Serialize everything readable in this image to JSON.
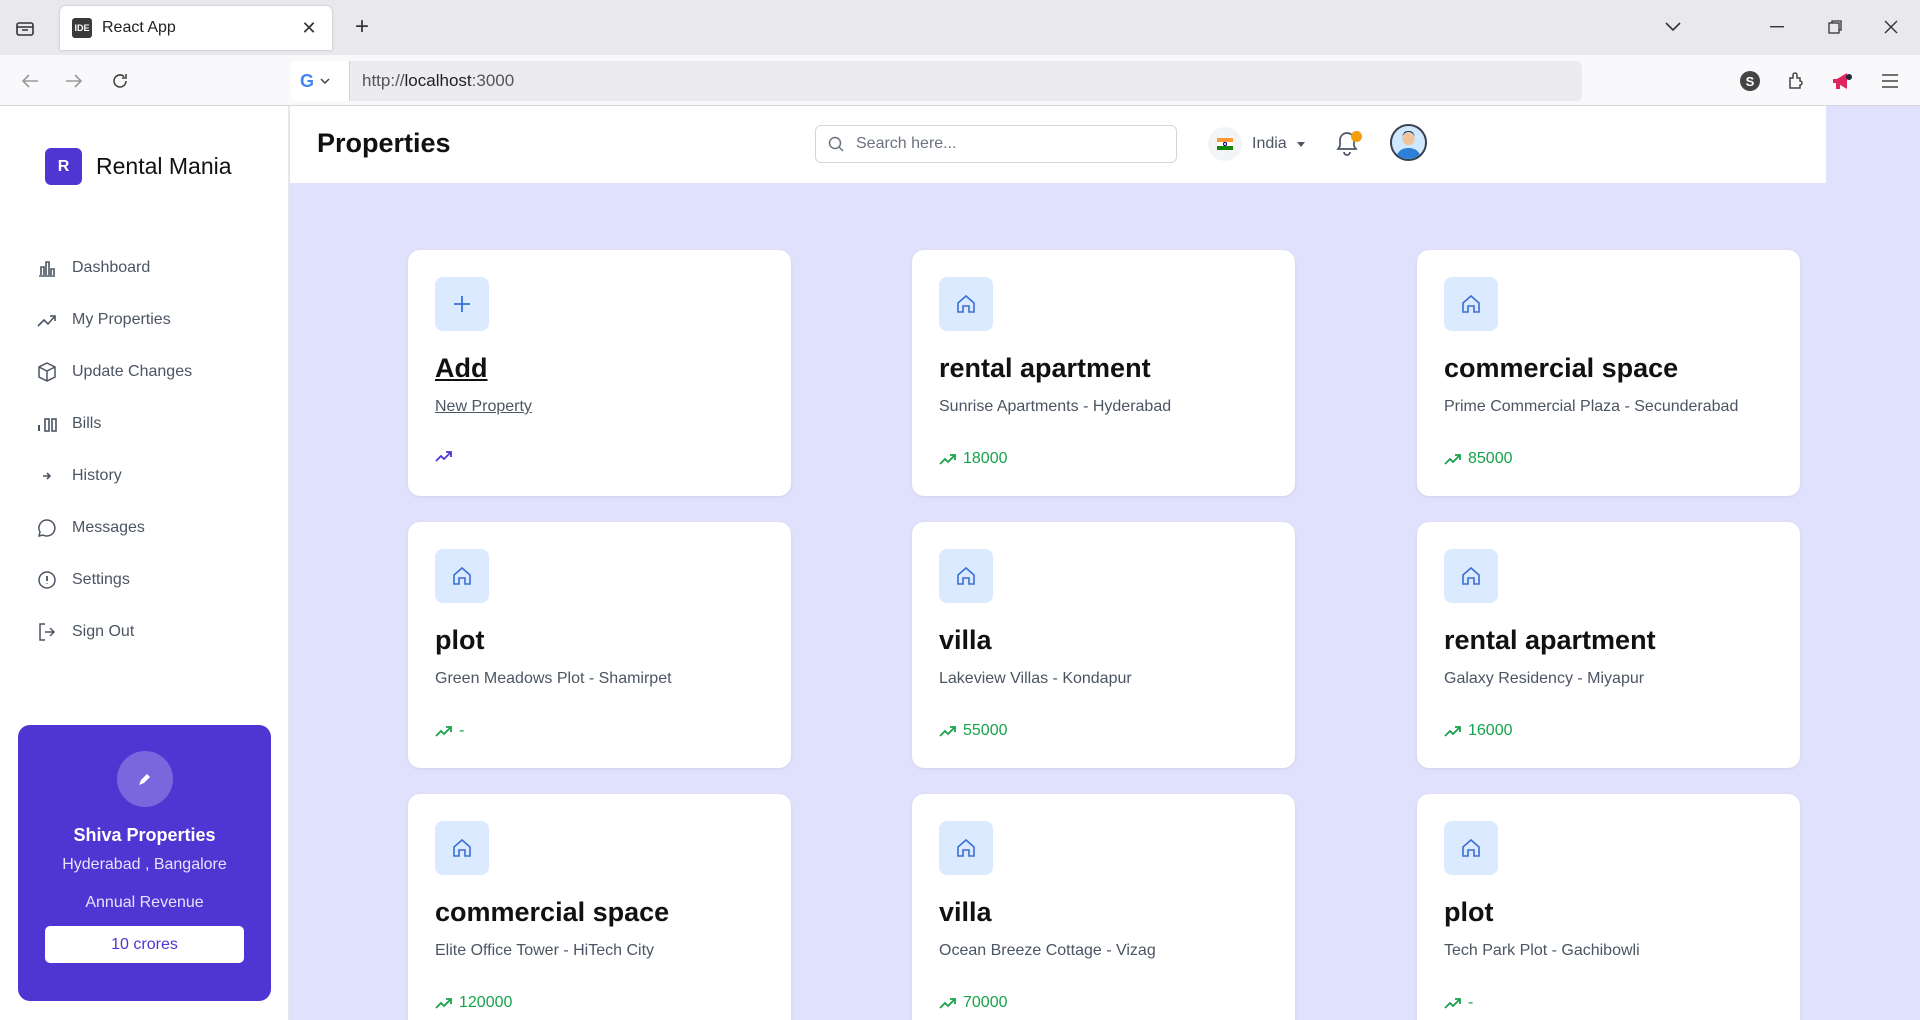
{
  "browser": {
    "tab_title": "React App",
    "favicon_text": "IDE",
    "url_prefix": "http://",
    "url_host": "localhost",
    "url_suffix": ":3000"
  },
  "sidebar": {
    "brand_letter": "R",
    "brand_name": "Rental Mania",
    "items": [
      {
        "label": "Dashboard",
        "icon": "bar-chart-icon"
      },
      {
        "label": "My Properties",
        "icon": "trending-up-icon"
      },
      {
        "label": "Update Changes",
        "icon": "box-icon"
      },
      {
        "label": "Bills",
        "icon": "bills-icon"
      },
      {
        "label": "History",
        "icon": "arrow-right-icon"
      },
      {
        "label": "Messages",
        "icon": "message-icon"
      },
      {
        "label": "Settings",
        "icon": "info-icon"
      },
      {
        "label": "Sign Out",
        "icon": "sign-out-icon"
      }
    ],
    "promo": {
      "name": "Shiva Properties",
      "locations": "Hyderabad , Bangalore",
      "label": "Annual Revenue",
      "value": "10 crores"
    }
  },
  "header": {
    "title": "Properties",
    "search_placeholder": "Search here...",
    "country": "India"
  },
  "cards": [
    {
      "title": "Add",
      "subtitle": "New Property",
      "stat": "",
      "icon": "plus-icon"
    },
    {
      "title": "rental apartment",
      "subtitle": "Sunrise Apartments - Hyderabad",
      "stat": "18000",
      "icon": "home-icon"
    },
    {
      "title": "commercial space",
      "subtitle": "Prime Commercial Plaza - Secunderabad",
      "stat": "85000",
      "icon": "home-icon"
    },
    {
      "title": "plot",
      "subtitle": "Green Meadows Plot - Shamirpet",
      "stat": "-",
      "icon": "home-icon"
    },
    {
      "title": "villa",
      "subtitle": "Lakeview Villas - Kondapur",
      "stat": "55000",
      "icon": "home-icon"
    },
    {
      "title": "rental apartment",
      "subtitle": "Galaxy Residency - Miyapur",
      "stat": "16000",
      "icon": "home-icon"
    },
    {
      "title": "commercial space",
      "subtitle": "Elite Office Tower - HiTech City",
      "stat": "120000",
      "icon": "home-icon"
    },
    {
      "title": "villa",
      "subtitle": "Ocean Breeze Cottage - Vizag",
      "stat": "70000",
      "icon": "home-icon"
    },
    {
      "title": "plot",
      "subtitle": "Tech Park Plot - Gachibowli",
      "stat": "-",
      "icon": "home-icon"
    }
  ],
  "colors": {
    "accent": "#4f35d2",
    "background": "#e0e1fc",
    "stat_green": "#16a34a",
    "icon_bg": "#dbeafe"
  }
}
